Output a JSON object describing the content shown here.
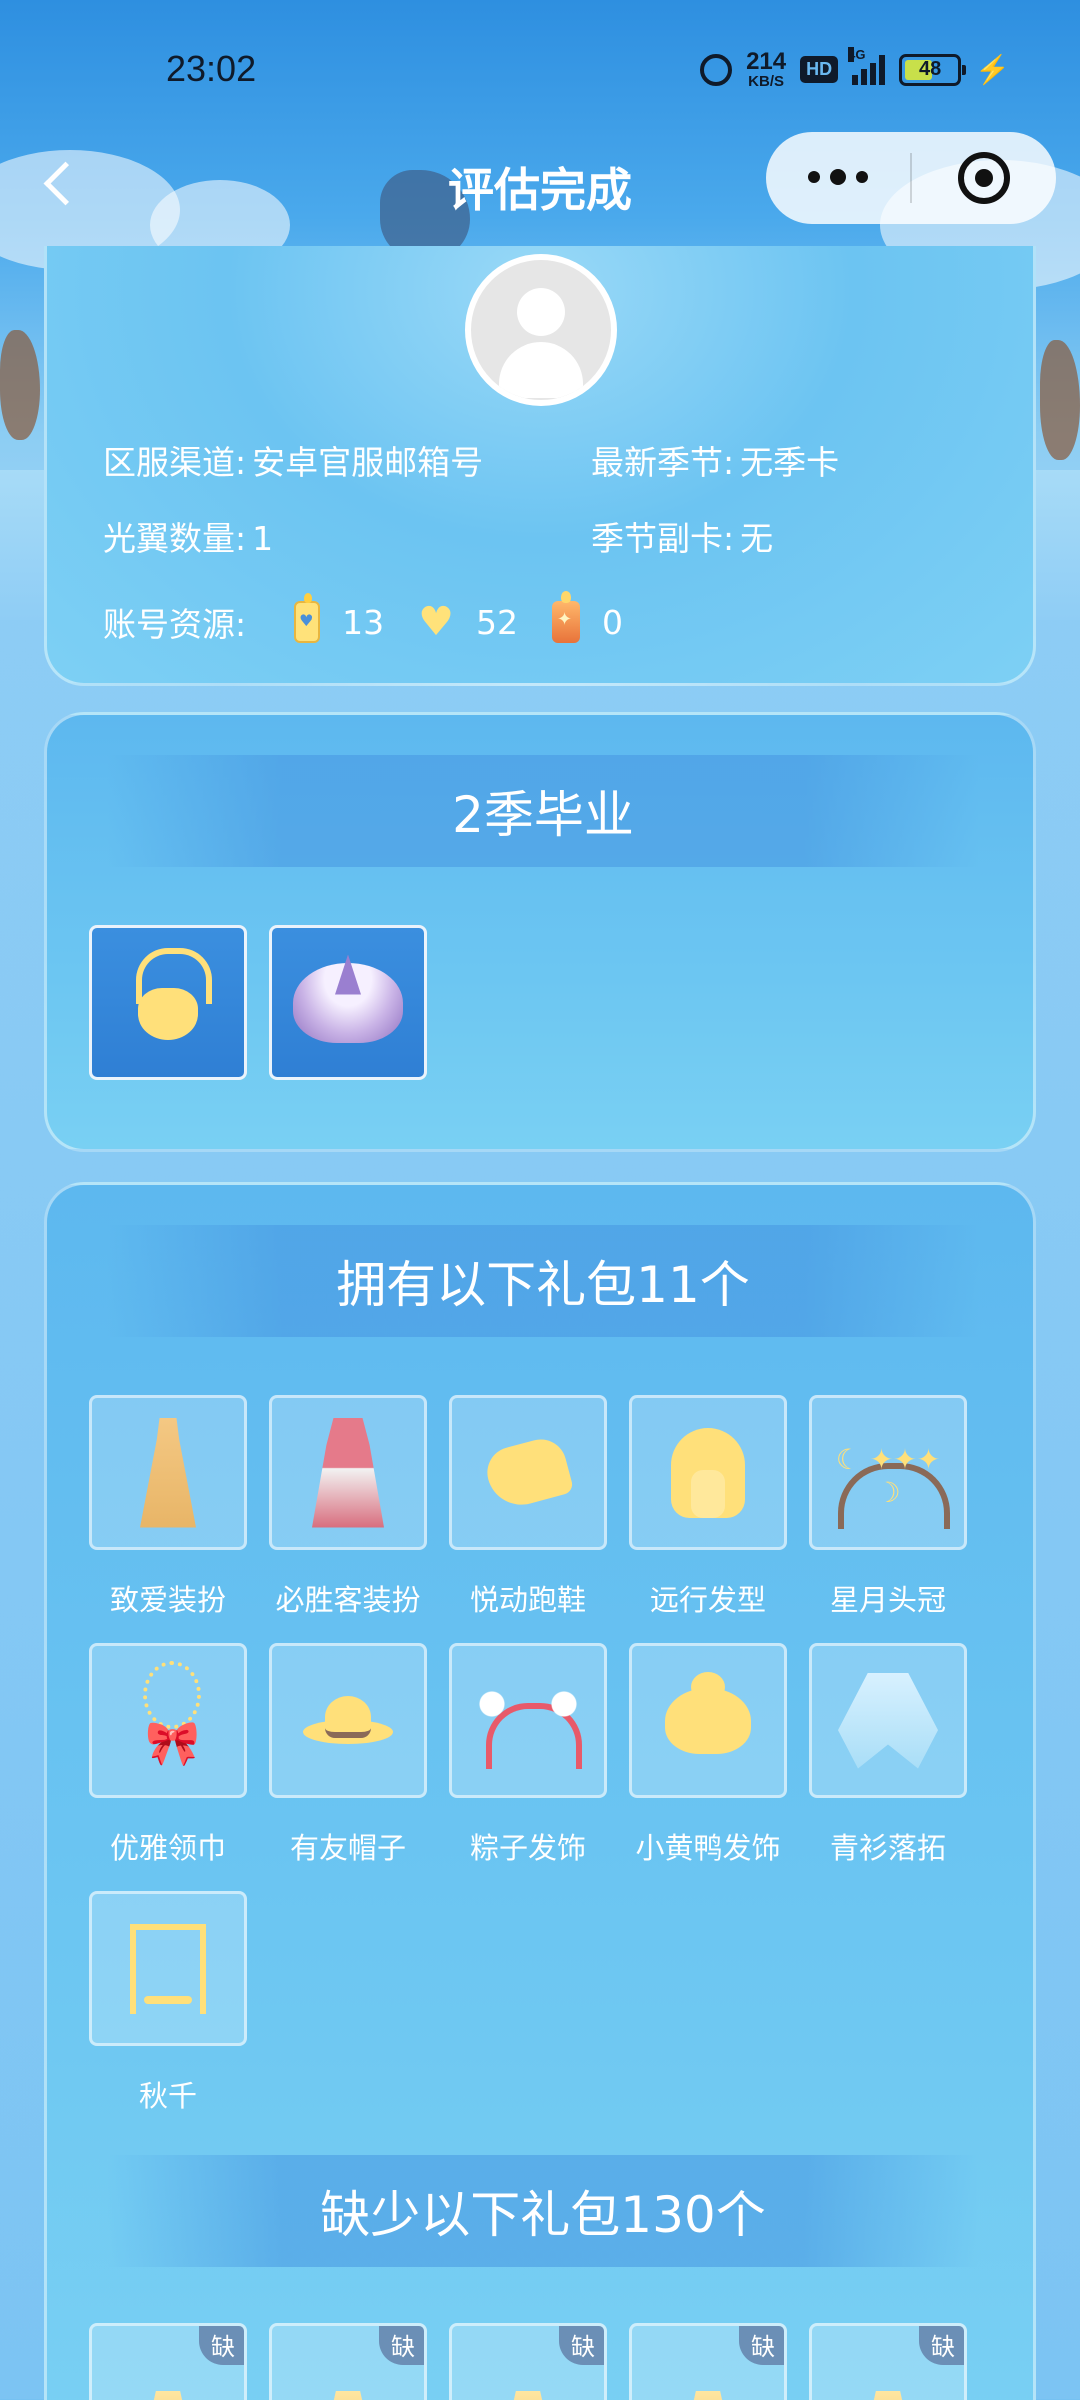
{
  "status_bar": {
    "time": "23:02",
    "net_speed_value": "214",
    "net_speed_unit": "KB/S",
    "hd_label": "HD",
    "network_type": "4G",
    "battery_level": "48"
  },
  "nav": {
    "title": "评估完成"
  },
  "profile": {
    "fields": [
      {
        "label": "区服渠道:",
        "value": "安卓官服邮箱号"
      },
      {
        "label": "最新季节:",
        "value": "无季卡"
      },
      {
        "label": "光翼数量:",
        "value": "1"
      },
      {
        "label": "季节副卡:",
        "value": "无"
      }
    ],
    "resources_label": "账号资源:",
    "resources": [
      {
        "icon": "candle-icon",
        "value": "13"
      },
      {
        "icon": "heart-icon",
        "value": "52"
      },
      {
        "icon": "season-candle-icon",
        "value": "0"
      }
    ]
  },
  "season": {
    "title": "2季毕业",
    "items": [
      {
        "icon": "mask-icon"
      },
      {
        "icon": "cape-icon"
      }
    ]
  },
  "owned": {
    "title": "拥有以下礼包11个",
    "items": [
      {
        "label": "致爱装扮",
        "icon": "dress-icon"
      },
      {
        "label": "必胜客装扮",
        "icon": "outfit-icon"
      },
      {
        "label": "悦动跑鞋",
        "icon": "shoe-icon"
      },
      {
        "label": "远行发型",
        "icon": "hair-icon"
      },
      {
        "label": "星月头冠",
        "icon": "crown-icon"
      },
      {
        "label": "优雅领巾",
        "icon": "scarf-icon"
      },
      {
        "label": "有友帽子",
        "icon": "hat-icon"
      },
      {
        "label": "粽子发饰",
        "icon": "ears-icon"
      },
      {
        "label": "小黄鸭发饰",
        "icon": "duck-icon"
      },
      {
        "label": "青衫落拓",
        "icon": "cape-icon"
      },
      {
        "label": "秋千",
        "icon": "swing-icon"
      }
    ]
  },
  "missing": {
    "title": "缺少以下礼包130个",
    "badge": "缺"
  }
}
